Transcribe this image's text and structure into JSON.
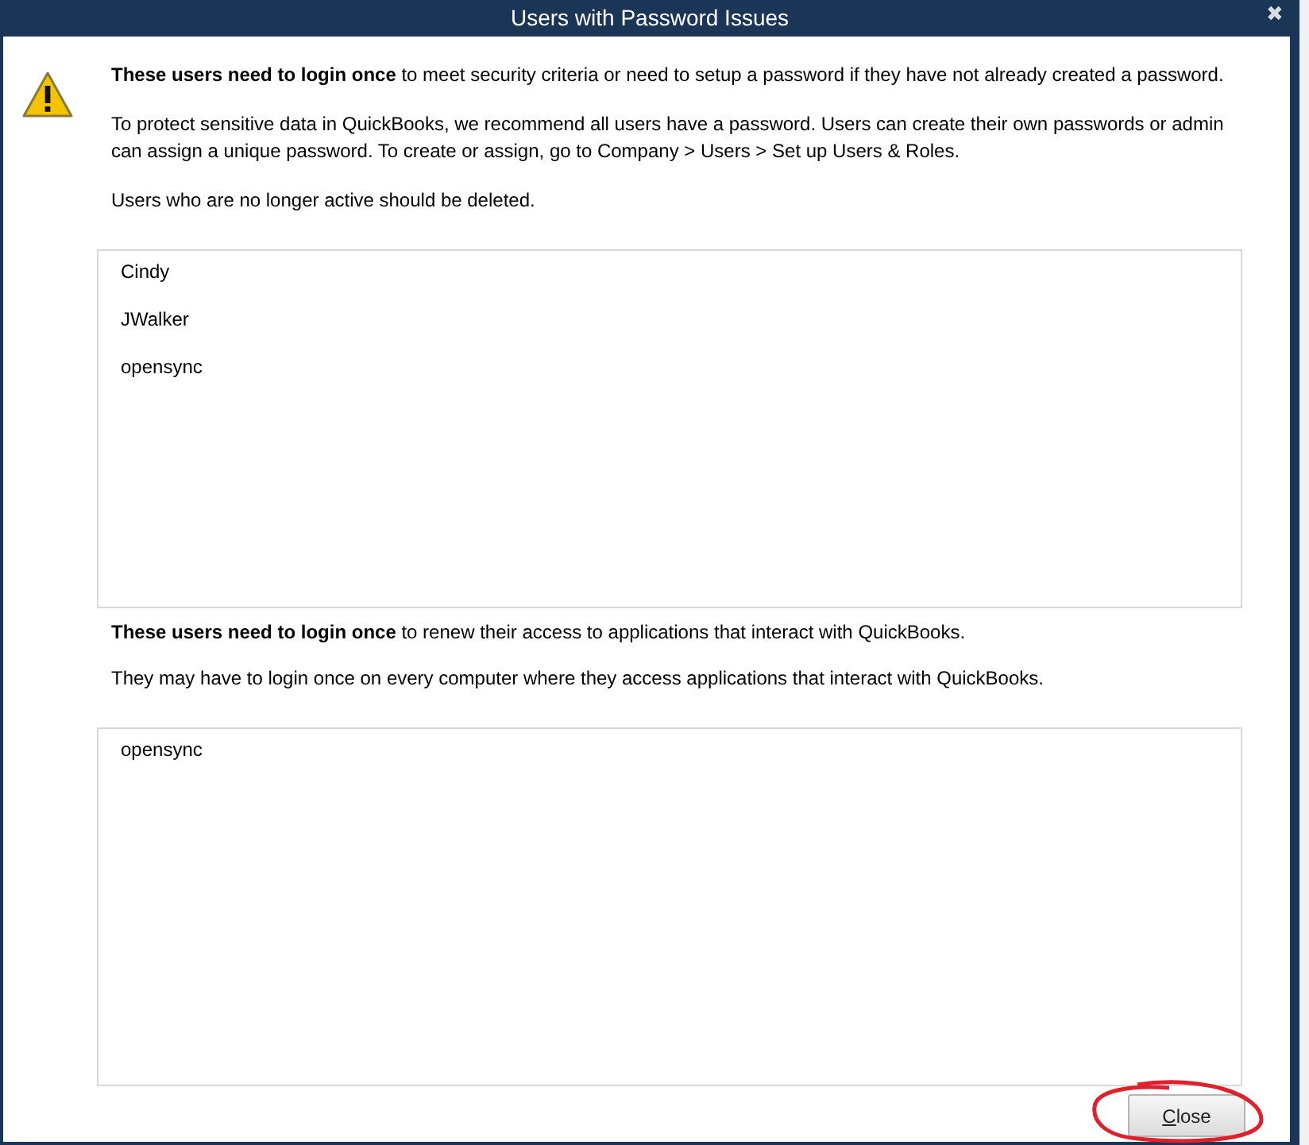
{
  "window": {
    "title": "Users with Password Issues",
    "close": "✖"
  },
  "intro": [
    "**These users need to login once** to meet security criteria or need to setup a password if they have not already created a password.",
    " To protect sensitive data in QuickBooks, we recommend all users have a password. Users can create their own passwords or admin can assign a unique password. To create or assign, go to Company > Users > Set up Users & Roles.",
    "Users who are no longer active should be deleted."
  ],
  "password_users": [
    "Cindy",
    "JWalker",
    "opensync"
  ],
  "apps_text": [
    "**These users need to login once** to renew their access to applications that interact with QuickBooks.",
    "They may have to login once on every computer where they access applications that interact with QuickBooks."
  ],
  "app_users": [
    "opensync"
  ],
  "buttons": [
    "Close"
  ]
}
